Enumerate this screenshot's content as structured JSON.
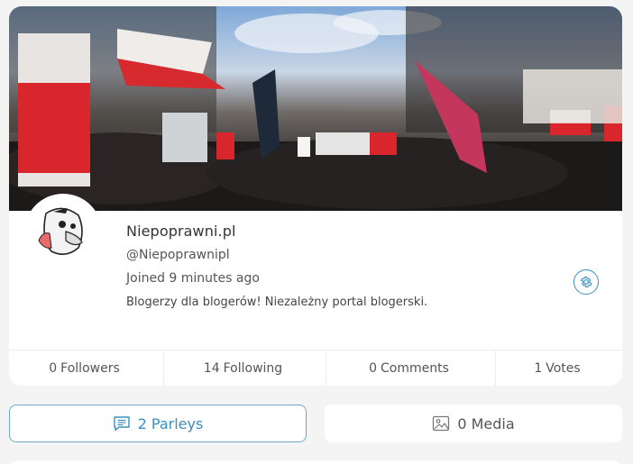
{
  "profile": {
    "display_name": "Niepoprawni.pl",
    "handle": "@Niepoprawnipl",
    "joined": "Joined 9 minutes ago",
    "bio": "Blogerzy dla blogerów! Niezależny portal blogerski.",
    "banner_icon": "banner-photo",
    "avatar_icon": "avatar-image",
    "settings_icon": "gear-icon"
  },
  "stats": [
    {
      "count": "0",
      "label": "Followers"
    },
    {
      "count": "14",
      "label": "Following"
    },
    {
      "count": "0",
      "label": "Comments"
    },
    {
      "count": "1",
      "label": "Votes"
    }
  ],
  "tabs": {
    "parleys": {
      "count": "2",
      "label": "Parleys",
      "icon": "chat-icon"
    },
    "media": {
      "count": "0",
      "label": "Media",
      "icon": "image-icon"
    }
  },
  "colors": {
    "accent": "#3a8fbf",
    "page_bg": "#f4f4f4",
    "card_bg": "#ffffff"
  }
}
